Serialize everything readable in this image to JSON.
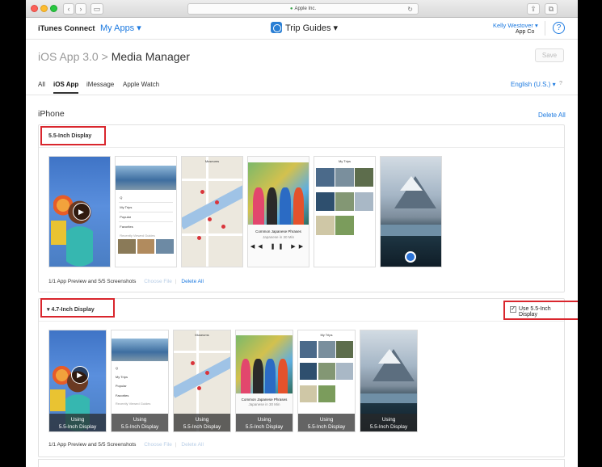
{
  "browser": {
    "url": "Apple Inc.",
    "nav_back": "‹",
    "nav_forward": "›"
  },
  "header": {
    "brand": "iTunes Connect",
    "my_apps": "My Apps ▾",
    "app_name": "Trip Guides ▾",
    "user_name": "Kelly Westover ▾",
    "user_company": "App Co",
    "help": "?"
  },
  "page": {
    "breadcrumb_parent": "iOS App 3.0",
    "breadcrumb_sep": " > ",
    "title": "Media Manager",
    "save_label": "Save"
  },
  "tabs": {
    "items": [
      "All",
      "iOS App",
      "iMessage",
      "Apple Watch"
    ],
    "active": "iOS App",
    "language": "English (U.S.) ▾",
    "language_help": "?"
  },
  "device_section": {
    "label": "iPhone",
    "delete_all": "Delete All"
  },
  "panel_55": {
    "label": "5.5-Inch Display",
    "footer_count": "1/1 App Preview and 5/5 Screenshots",
    "choose_file": "Choose File",
    "delete_all": "Delete All",
    "screens": {
      "search": "Q",
      "my_trips": "My Trips",
      "popular": "Popular",
      "favorites": "Favorites",
      "recently": "Recently Viewed Guides",
      "museums": "Museums",
      "song_title": "Common Japanese Phrases",
      "song_artist": "Japanese in 30 Min",
      "my_trips_title": "My Trips"
    }
  },
  "panel_47": {
    "label": "4.7-Inch Display",
    "use_55_label": "Use 5.5-Inch Display",
    "use_55_checked": true,
    "overlay_line1": "Using",
    "overlay_line2": "5.5-Inch Display",
    "footer_count": "1/1 App Preview and 5/5 Screenshots",
    "choose_file": "Choose File",
    "delete_all": "Delete All"
  },
  "colors": {
    "accent": "#1d7ae0",
    "highlight_box": "#d9262d"
  },
  "icons": {
    "play": "play-icon",
    "help": "help-icon",
    "app": "trip-guides-app-icon",
    "lock": "lock-icon"
  }
}
